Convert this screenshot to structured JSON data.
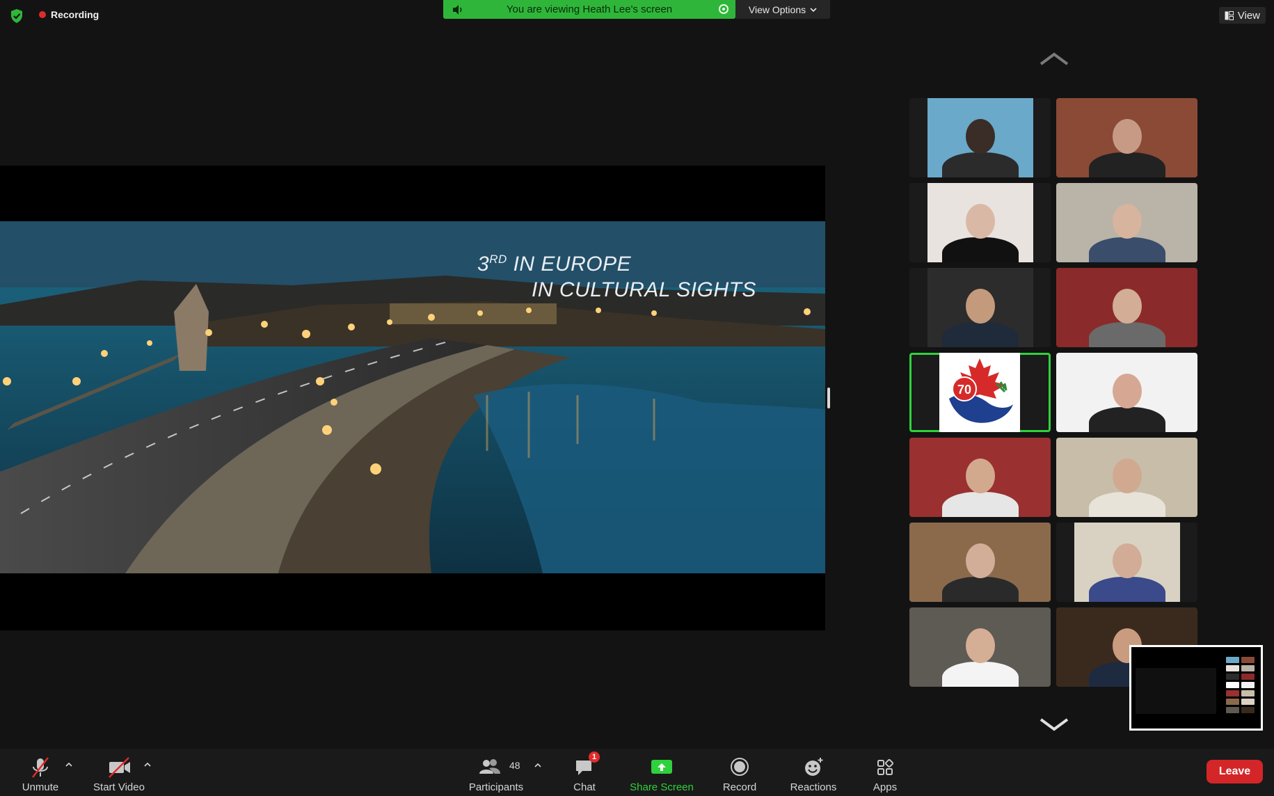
{
  "top": {
    "recording_label": "Recording",
    "banner_text": "You are viewing Heath Lee's screen",
    "view_options_label": "View Options",
    "view_label": "View"
  },
  "shared_screen": {
    "caption_line1_prefix": "3",
    "caption_line1_sup": "RD",
    "caption_line1_rest": " IN EUROPE",
    "caption_line2": "IN CULTURAL SIGHTS"
  },
  "gallery": {
    "tiles": [
      {
        "id": "t1",
        "bg": "#6aa9c9",
        "skin": "#3a2c26",
        "shirt": "#2b2b2b",
        "narrow": true
      },
      {
        "id": "t2",
        "bg": "#8a4a36",
        "skin": "#c79a86",
        "shirt": "#222222",
        "narrow": false
      },
      {
        "id": "t3",
        "bg": "#e9e3df",
        "skin": "#d9b9a6",
        "shirt": "#111111",
        "narrow": true
      },
      {
        "id": "t4",
        "bg": "#b9b3a8",
        "skin": "#d7b49e",
        "shirt": "#3a4d6a",
        "narrow": false
      },
      {
        "id": "t5",
        "bg": "#2c2c2c",
        "skin": "#c49a7c",
        "shirt": "#1f2a3a",
        "narrow": true
      },
      {
        "id": "t6",
        "bg": "#8b2a2a",
        "skin": "#d3ad95",
        "shirt": "#6a6a6a",
        "narrow": false
      },
      {
        "id": "t7",
        "logo_text": "70",
        "active": true
      },
      {
        "id": "t8",
        "bg": "#f2f2f2",
        "skin": "#d6a893",
        "shirt": "#222222",
        "narrow": false
      },
      {
        "id": "t9",
        "bg": "#9a3030",
        "skin": "#d3a98e",
        "shirt": "#e6e6e6",
        "narrow": false
      },
      {
        "id": "t10",
        "bg": "#c7bda9",
        "skin": "#d1a991",
        "shirt": "#e8e3d8",
        "narrow": false
      },
      {
        "id": "t11",
        "bg": "#8b6a4c",
        "skin": "#d2ad98",
        "shirt": "#2a2a2a",
        "narrow": false
      },
      {
        "id": "t12",
        "bg": "#d9d2c2",
        "skin": "#d2ac96",
        "shirt": "#3a4a8a",
        "narrow": true
      },
      {
        "id": "t13",
        "bg": "#5e5a54",
        "skin": "#d5ae96",
        "shirt": "#f4f4f4",
        "narrow": false
      },
      {
        "id": "t14",
        "bg": "#3a2a1e",
        "skin": "#c99c80",
        "shirt": "#1e2a40",
        "narrow": false
      }
    ]
  },
  "toolbar": {
    "unmute_label": "Unmute",
    "start_video_label": "Start Video",
    "participants_label": "Participants",
    "participants_count": "48",
    "chat_label": "Chat",
    "chat_badge": "1",
    "share_screen_label": "Share Screen",
    "record_label": "Record",
    "reactions_label": "Reactions",
    "apps_label": "Apps",
    "leave_label": "Leave"
  },
  "colors": {
    "accent_green": "#2fd13d",
    "leave_red": "#d42628",
    "banner_green": "#2fb63a"
  }
}
